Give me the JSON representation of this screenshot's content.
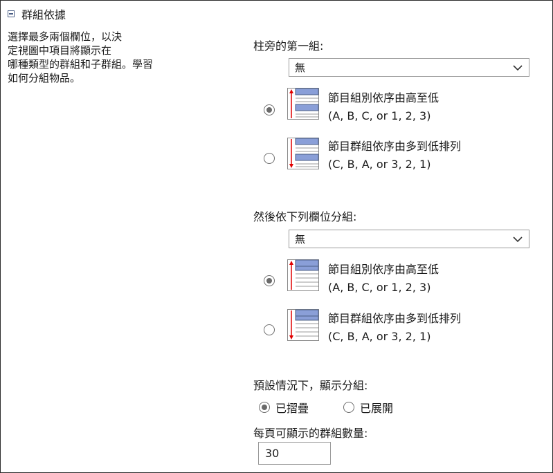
{
  "header": {
    "title": "群組依據"
  },
  "description": [
    "選擇最多兩個欄位，以決",
    "定視圖中項目將顯示在",
    "哪種類型的群組和子群組。學習",
    "如何分組物品。"
  ],
  "first_group": {
    "label": "柱旁的第一組:",
    "select_value": "無",
    "asc": {
      "line1": "節目組別依序由高至低",
      "line2": "(A, B, C, or 1, 2, 3)"
    },
    "desc": {
      "line1": "節目群組依序由多到低排列",
      "line2": "(C, B, A, or 3, 2, 1)"
    }
  },
  "second_group": {
    "label": "然後依下列欄位分組:",
    "select_value": "無",
    "asc": {
      "line1": "節目組別依序由高至低",
      "line2": "(A, B, C, or 1, 2, 3)"
    },
    "desc": {
      "line1": "節目群組依序由多到低排列",
      "line2": "(C, B, A, or 3, 2, 1)"
    }
  },
  "default_display": {
    "label": "預設情況下，顯示分組:",
    "collapsed": "已摺疊",
    "expanded": "已展開",
    "selected": "collapsed"
  },
  "groups_per_page": {
    "label": "每頁可顯示的群組數量:",
    "value": "30"
  },
  "colors": {
    "header_bar": "#8a9fd8",
    "header_border": "#4a5e85",
    "arrow": "#e00000"
  }
}
